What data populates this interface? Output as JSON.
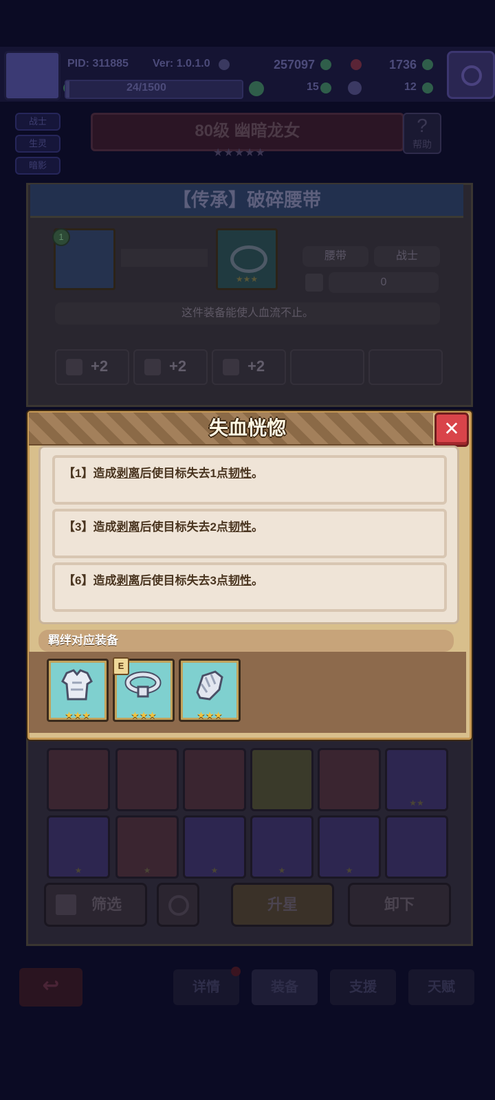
{
  "hud": {
    "pid": "PID: 311885",
    "version": "Ver: 1.0.1.0",
    "gold": "257097",
    "gems": "1736",
    "exp": "24/1500",
    "currency_a": "15",
    "currency_b": "12"
  },
  "side_tags": [
    "战士",
    "生灵",
    "暗影"
  ],
  "hero": {
    "title": "80级  幽暗龙女",
    "stars": "★★★★★",
    "help_label": "帮助"
  },
  "equipment": {
    "title": "【传承】破碎腰带",
    "level_badge": "1",
    "type": "腰带",
    "class": "战士",
    "power": "0",
    "stars": "★★★",
    "description": "这件装备能使人血流不止。",
    "stats": [
      "+2",
      "+2",
      "+2"
    ]
  },
  "popup": {
    "title": "失血恍惚",
    "close_label": "✕",
    "effects": [
      {
        "prefix": "【1】造成",
        "keyword": "剥离",
        "mid": "后使目标失去1点",
        "keyword2": "韧性",
        "suffix": "。"
      },
      {
        "prefix": "【3】造成",
        "keyword": "剥离",
        "mid": "后使目标失去2点",
        "keyword2": "韧性",
        "suffix": "。"
      },
      {
        "prefix": "【6】造成",
        "keyword": "剥离",
        "mid": "后使目标失去3点",
        "keyword2": "韧性",
        "suffix": "。"
      }
    ],
    "bond_label": "羁绊对应装备",
    "bond_items": [
      {
        "icon": "armor-icon",
        "stars": "★★★"
      },
      {
        "icon": "belt-icon",
        "stars": "★★★",
        "badge": "E"
      },
      {
        "icon": "gauntlet-icon",
        "stars": "★★★"
      }
    ]
  },
  "inventory": {
    "row1_stars": [
      "",
      "",
      "",
      "",
      "",
      "★★"
    ],
    "row2_stars": [
      "★",
      "★",
      "★",
      "★",
      "★",
      ""
    ]
  },
  "actions": {
    "filter_label": "筛选",
    "upgrade_label": "升星",
    "unequip_label": "卸下"
  },
  "bottom_tabs": [
    "详情",
    "装备",
    "支援",
    "天赋"
  ],
  "colors": {
    "popup_bg": "#d8bf8c",
    "close_red": "#d9444a",
    "bond_cyan": "#7fd0cf",
    "star_gold": "#f3c33d"
  }
}
